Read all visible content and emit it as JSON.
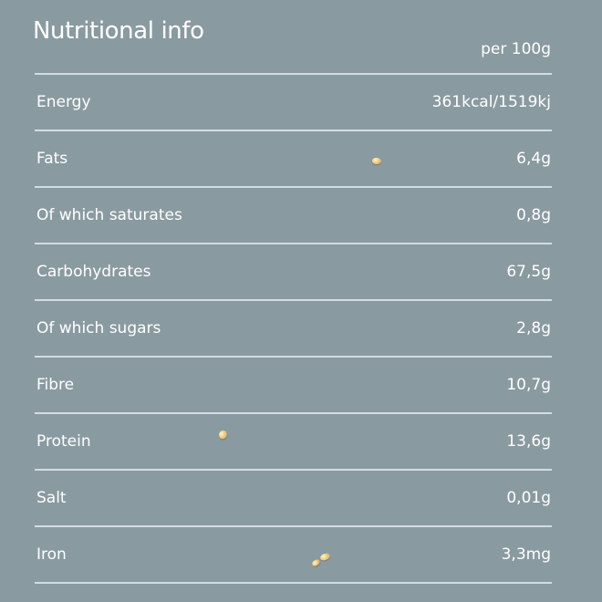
{
  "header": {
    "title": "Nutritional info",
    "per_label": "per 100g"
  },
  "rows": [
    {
      "label": "Energy",
      "value": "361kcal/1519kj"
    },
    {
      "label": "Fats",
      "value": "6,4g"
    },
    {
      "label": "Of which saturates",
      "value": "0,8g"
    },
    {
      "label": "Carbohydrates",
      "value": "67,5g"
    },
    {
      "label": "Of which sugars",
      "value": "2,8g"
    },
    {
      "label": "Fibre",
      "value": "10,7g"
    },
    {
      "label": "Protein",
      "value": "13,6g"
    },
    {
      "label": "Salt",
      "value": "0,01g"
    },
    {
      "label": "Iron",
      "value": "3,3mg"
    }
  ],
  "colors": {
    "background": "#8a9aa1",
    "text": "#ffffff",
    "divider": "#dbe3e8"
  }
}
